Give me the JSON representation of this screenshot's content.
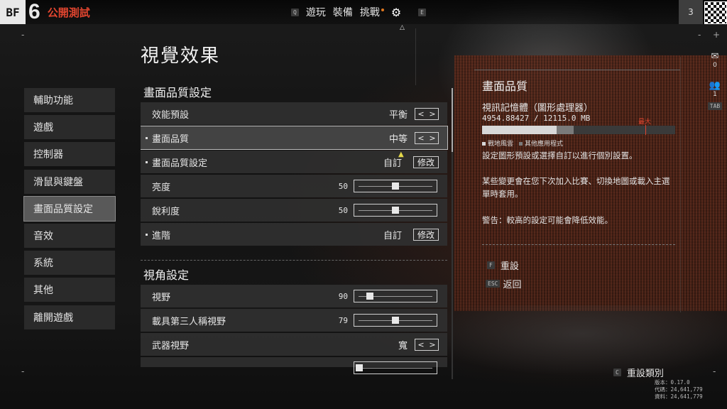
{
  "header": {
    "logo_bf": "BF",
    "logo_num": "6",
    "logo_sub": "公開測試",
    "nav_left_key": "Q",
    "nav_tabs": [
      {
        "label": "遊玩"
      },
      {
        "label": "裝備"
      },
      {
        "label": "挑戰"
      }
    ],
    "nav_right_key": "E",
    "player_level": "3"
  },
  "page_title": "視覺效果",
  "sidebar": {
    "items": [
      {
        "label": "輔助功能"
      },
      {
        "label": "遊戲"
      },
      {
        "label": "控制器"
      },
      {
        "label": "滑鼠與鍵盤"
      },
      {
        "label": "畫面品質設定"
      },
      {
        "label": "音效"
      },
      {
        "label": "系統"
      },
      {
        "label": "其他"
      },
      {
        "label": "離開遊戲"
      }
    ],
    "active_index": 4
  },
  "section_graphics": {
    "title": "畫面品質設定",
    "rows": [
      {
        "label": "效能預設",
        "value": "平衡"
      },
      {
        "label": "畫面品質",
        "value": "中等"
      },
      {
        "label": "畫面品質設定",
        "value": "自訂",
        "button": "修改"
      },
      {
        "label": "亮度",
        "value": "50",
        "slider": 0.5
      },
      {
        "label": "銳利度",
        "value": "50",
        "slider": 0.5
      },
      {
        "label": "進階",
        "value": "自訂",
        "button": "修改"
      }
    ]
  },
  "section_view": {
    "title": "視角設定",
    "rows": [
      {
        "label": "視野",
        "value": "90",
        "slider": 0.12
      },
      {
        "label": "載具第三人稱視野",
        "value": "79",
        "slider": 0.5
      },
      {
        "label": "武器視野",
        "value": "寬"
      }
    ]
  },
  "info": {
    "title": "畫面品質",
    "vram_label": "視訊記憶體（圖形處理器）",
    "vram_numbers": "4954.88427 / 12115.0 MB",
    "vram_game_fraction": 0.385,
    "vram_other_fraction": 0.09,
    "max_label": "最大",
    "legend_game": "戰地風雲",
    "legend_other": "其他應用程式",
    "desc1": "設定圖形預設或選擇自訂以進行個別設置。",
    "desc2": "某些變更會在您下次加入比賽、切換地圖或載入主選單時套用。",
    "desc3": "警告：較高的設定可能會降低效能。",
    "reset_key": "F",
    "reset_label": "重設",
    "back_key": "ESC",
    "back_label": "返回"
  },
  "side": {
    "mail_count": "0",
    "party_count": "1",
    "tab_key": "TAB"
  },
  "footer": {
    "reset_category_key": "C",
    "reset_category_label": "重設類別",
    "version_line": "版本：0.17.0",
    "code_line": "代碼：24,641,779",
    "data_line": "資料：24,641,779"
  },
  "colors": {
    "accent_red": "#e0452f",
    "notify_orange": "#e07820"
  }
}
